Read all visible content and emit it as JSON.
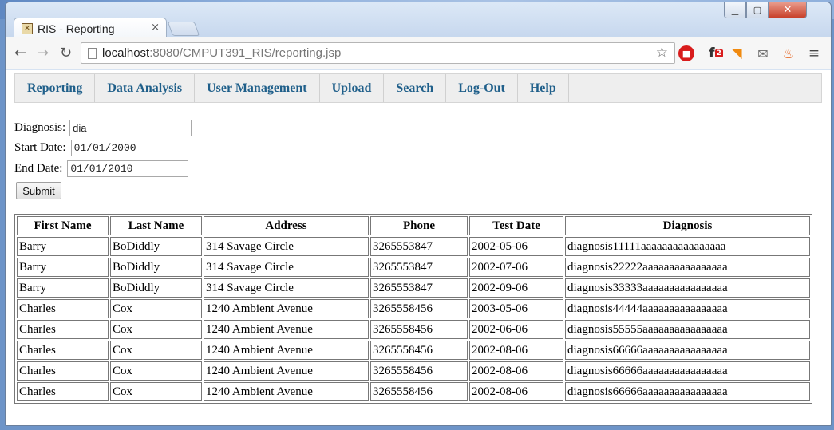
{
  "browser": {
    "tab_title": "RIS - Reporting",
    "tab_close": "×",
    "url_host": "localhost",
    "url_rest": ":8080/CMPUT391_RIS/reporting.jsp"
  },
  "nav": {
    "items": [
      "Reporting",
      "Data Analysis",
      "User Management",
      "Upload",
      "Search",
      "Log-Out",
      "Help"
    ]
  },
  "form": {
    "diagnosis_label": "Diagnosis:",
    "diagnosis_value": "dia",
    "start_label": "Start Date:",
    "start_value": "01/01/2000",
    "end_label": "End Date:",
    "end_value": "01/01/2010",
    "submit_label": "Submit"
  },
  "table": {
    "headers": [
      "First Name",
      "Last Name",
      "Address",
      "Phone",
      "Test Date",
      "Diagnosis"
    ],
    "rows": [
      [
        "Barry",
        "BoDiddly",
        "314 Savage Circle",
        "3265553847",
        "2002-05-06",
        "diagnosis11111aaaaaaaaaaaaaaaa"
      ],
      [
        "Barry",
        "BoDiddly",
        "314 Savage Circle",
        "3265553847",
        "2002-07-06",
        "diagnosis22222aaaaaaaaaaaaaaaa"
      ],
      [
        "Barry",
        "BoDiddly",
        "314 Savage Circle",
        "3265553847",
        "2002-09-06",
        "diagnosis33333aaaaaaaaaaaaaaaa"
      ],
      [
        "Charles",
        "Cox",
        "1240 Ambient Avenue",
        "3265558456",
        "2003-05-06",
        "diagnosis44444aaaaaaaaaaaaaaaa"
      ],
      [
        "Charles",
        "Cox",
        "1240 Ambient Avenue",
        "3265558456",
        "2002-06-06",
        "diagnosis55555aaaaaaaaaaaaaaaa"
      ],
      [
        "Charles",
        "Cox",
        "1240 Ambient Avenue",
        "3265558456",
        "2002-08-06",
        "diagnosis66666aaaaaaaaaaaaaaaa"
      ],
      [
        "Charles",
        "Cox",
        "1240 Ambient Avenue",
        "3265558456",
        "2002-08-06",
        "diagnosis66666aaaaaaaaaaaaaaaa"
      ],
      [
        "Charles",
        "Cox",
        "1240 Ambient Avenue",
        "3265558456",
        "2002-08-06",
        "diagnosis66666aaaaaaaaaaaaaaaa"
      ]
    ]
  },
  "icons": {
    "favicon": "ris-favicon-icon",
    "back": "back-arrow-icon",
    "forward": "forward-arrow-icon",
    "reload": "reload-icon",
    "star": "bookmark-star-icon",
    "menu": "browser-menu-icon"
  },
  "colors": {
    "nav_link": "#1f5f8a",
    "nav_bg": "#eeeeee",
    "close_button": "#c8402a"
  }
}
